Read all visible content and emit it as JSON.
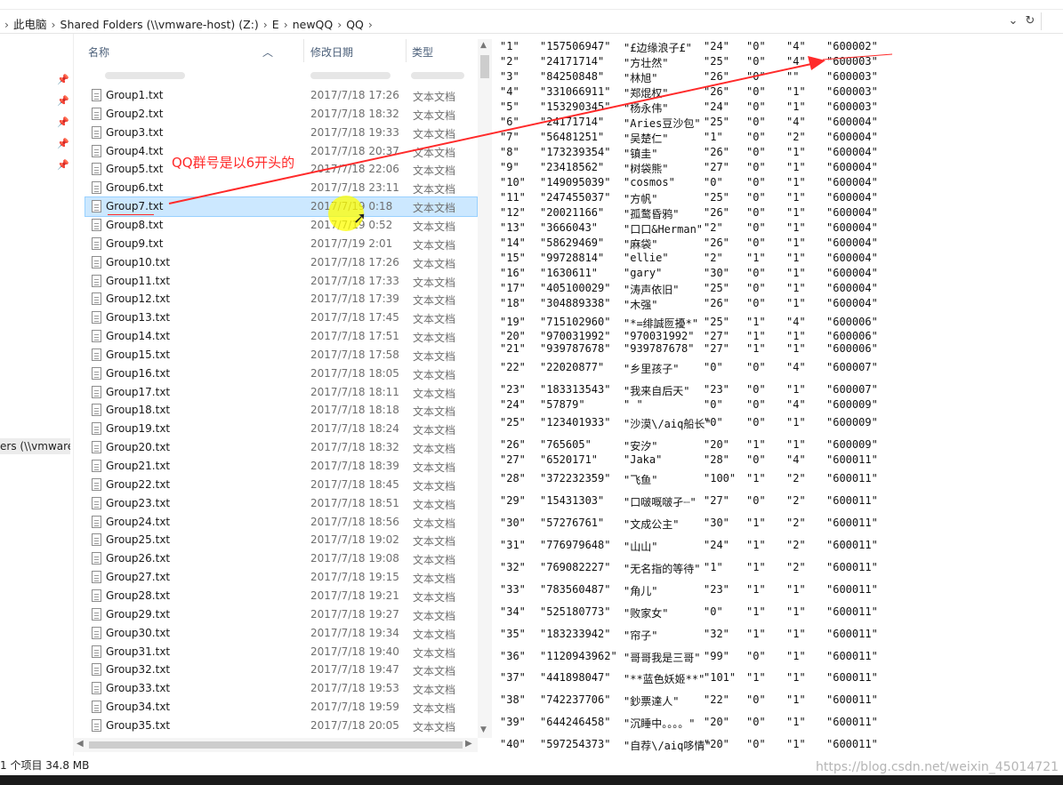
{
  "address": {
    "crumbs": [
      "此电脑",
      "Shared Folders (\\\\vmware-host) (Z:)",
      "E",
      "newQQ",
      "QQ"
    ],
    "refresh_icon": "refresh-icon",
    "dropdown_icon": "chevron-down-icon"
  },
  "nav": {
    "item_label": "ers (\\\\vmware-"
  },
  "columns": {
    "name": "名称",
    "date": "修改日期",
    "type": "类型"
  },
  "files": [
    {
      "name": "Group1.txt",
      "date": "2017/7/18 17:26",
      "type": "文本文档"
    },
    {
      "name": "Group2.txt",
      "date": "2017/7/18 18:32",
      "type": "文本文档"
    },
    {
      "name": "Group3.txt",
      "date": "2017/7/18 19:33",
      "type": "文本文档"
    },
    {
      "name": "Group4.txt",
      "date": "2017/7/18 20:37",
      "type": "文本文档"
    },
    {
      "name": "Group5.txt",
      "date": "2017/7/18 22:06",
      "type": "文本文档"
    },
    {
      "name": "Group6.txt",
      "date": "2017/7/18 23:11",
      "type": "文本文档"
    },
    {
      "name": "Group7.txt",
      "date": "2017/7/19 0:18",
      "type": "文本文档",
      "selected": true
    },
    {
      "name": "Group8.txt",
      "date": "2017/7/19 0:52",
      "type": "文本文档"
    },
    {
      "name": "Group9.txt",
      "date": "2017/7/19 2:01",
      "type": "文本文档"
    },
    {
      "name": "Group10.txt",
      "date": "2017/7/18 17:26",
      "type": "文本文档"
    },
    {
      "name": "Group11.txt",
      "date": "2017/7/18 17:33",
      "type": "文本文档"
    },
    {
      "name": "Group12.txt",
      "date": "2017/7/18 17:39",
      "type": "文本文档"
    },
    {
      "name": "Group13.txt",
      "date": "2017/7/18 17:45",
      "type": "文本文档"
    },
    {
      "name": "Group14.txt",
      "date": "2017/7/18 17:51",
      "type": "文本文档"
    },
    {
      "name": "Group15.txt",
      "date": "2017/7/18 17:58",
      "type": "文本文档"
    },
    {
      "name": "Group16.txt",
      "date": "2017/7/18 18:05",
      "type": "文本文档"
    },
    {
      "name": "Group17.txt",
      "date": "2017/7/18 18:11",
      "type": "文本文档"
    },
    {
      "name": "Group18.txt",
      "date": "2017/7/18 18:18",
      "type": "文本文档"
    },
    {
      "name": "Group19.txt",
      "date": "2017/7/18 18:24",
      "type": "文本文档"
    },
    {
      "name": "Group20.txt",
      "date": "2017/7/18 18:32",
      "type": "文本文档"
    },
    {
      "name": "Group21.txt",
      "date": "2017/7/18 18:39",
      "type": "文本文档"
    },
    {
      "name": "Group22.txt",
      "date": "2017/7/18 18:45",
      "type": "文本文档"
    },
    {
      "name": "Group23.txt",
      "date": "2017/7/18 18:51",
      "type": "文本文档"
    },
    {
      "name": "Group24.txt",
      "date": "2017/7/18 18:56",
      "type": "文本文档"
    },
    {
      "name": "Group25.txt",
      "date": "2017/7/18 19:02",
      "type": "文本文档"
    },
    {
      "name": "Group26.txt",
      "date": "2017/7/18 19:08",
      "type": "文本文档"
    },
    {
      "name": "Group27.txt",
      "date": "2017/7/18 19:15",
      "type": "文本文档"
    },
    {
      "name": "Group28.txt",
      "date": "2017/7/18 19:21",
      "type": "文本文档"
    },
    {
      "name": "Group29.txt",
      "date": "2017/7/18 19:27",
      "type": "文本文档"
    },
    {
      "name": "Group30.txt",
      "date": "2017/7/18 19:34",
      "type": "文本文档"
    },
    {
      "name": "Group31.txt",
      "date": "2017/7/18 19:40",
      "type": "文本文档"
    },
    {
      "name": "Group32.txt",
      "date": "2017/7/18 19:47",
      "type": "文本文档"
    },
    {
      "name": "Group33.txt",
      "date": "2017/7/18 19:53",
      "type": "文本文档"
    },
    {
      "name": "Group34.txt",
      "date": "2017/7/18 19:59",
      "type": "文本文档"
    },
    {
      "name": "Group35.txt",
      "date": "2017/7/18 20:05",
      "type": "文本文档"
    }
  ],
  "status": {
    "text": "1 个项目  34.8 MB"
  },
  "annotation": {
    "text": "QQ群号是以6开头的"
  },
  "watermark": "https://blog.csdn.net/weixin_45014721",
  "data_lines": [
    [
      "\"1\"",
      "\"157506947\"",
      "\"£边缘浪子£\"",
      "\"24\"",
      "\"0\"",
      "\"4\"",
      "\"600002\""
    ],
    [
      "\"2\"",
      "\"24171714\"",
      "\"方壮然\"",
      "\"25\"",
      "\"0\"",
      "\"4\"",
      "\"600003\""
    ],
    [
      "\"3\"",
      "\"84250848\"",
      "\"林旭\"",
      "\"26\"",
      "\"0\"",
      "\"\"",
      "\"600003\""
    ],
    [
      "\"4\"",
      "\"331066911\"",
      "\"郑焜权\"",
      "\"26\"",
      "\"0\"",
      "\"1\"",
      "\"600003\""
    ],
    [
      "\"5\"",
      "\"153290345\"",
      "\"杨永伟\"",
      "\"24\"",
      "\"0\"",
      "\"1\"",
      "\"600003\""
    ],
    [
      "\"6\"",
      "\"24171714\"",
      "\"Aries豆沙包\"",
      "\"25\"",
      "\"0\"",
      "\"4\"",
      "\"600004\""
    ],
    [
      "\"7\"",
      "\"56481251\"",
      "\"吴楚仁\"",
      "\"1\"",
      "\"0\"",
      "\"2\"",
      "\"600004\""
    ],
    [
      "\"8\"",
      "\"173239354\"",
      "\"镇圭\"",
      "\"26\"",
      "\"0\"",
      "\"1\"",
      "\"600004\""
    ],
    [
      "\"9\"",
      "\"23418562\"",
      "\"树袋熊\"",
      "\"27\"",
      "\"0\"",
      "\"1\"",
      "\"600004\""
    ],
    [
      "\"10\"",
      "\"149095039\"",
      "\"cosmos\"",
      "\"0\"",
      "\"0\"",
      "\"1\"",
      "\"600004\""
    ],
    [
      "\"11\"",
      "\"247455037\"",
      "\"方帆\"",
      "\"25\"",
      "\"0\"",
      "\"1\"",
      "\"600004\""
    ],
    [
      "\"12\"",
      "\"20021166\"",
      "\"孤鹜昏鸦\"",
      "\"26\"",
      "\"0\"",
      "\"1\"",
      "\"600004\""
    ],
    [
      "\"13\"",
      "\"3666043\"",
      "\"口口&Herman\"",
      "\"2\"",
      "\"0\"",
      "\"1\"",
      "\"600004\""
    ],
    [
      "\"14\"",
      "\"58629469\"",
      "\"麻袋\"",
      "\"26\"",
      "\"0\"",
      "\"1\"",
      "\"600004\""
    ],
    [
      "\"15\"",
      "\"99728814\"",
      "\"ellie\"",
      "\"2\"",
      "\"1\"",
      "\"1\"",
      "\"600004\""
    ],
    [
      "\"16\"",
      "\"1630611\"",
      "\"gary\"",
      "\"30\"",
      "\"0\"",
      "\"1\"",
      "\"600004\""
    ],
    [
      "\"17\"",
      "\"405100029\"",
      "\"涛声依旧\"",
      "\"25\"",
      "\"0\"",
      "\"1\"",
      "\"600004\""
    ],
    [
      "\"18\"",
      "\"304889338\"",
      "\"木强\"",
      "\"26\"",
      "\"0\"",
      "\"1\"",
      "\"600004\""
    ],
    [
      "\"19\"",
      "\"715102960\"",
      "\"*=绯誠匢擾*\"",
      "\"25\"",
      "\"1\"",
      "\"4\"",
      "\"600006\""
    ],
    [
      "\"20\"",
      "\"970031992\"",
      "\"970031992\"",
      "\"27\"",
      "\"1\"",
      "\"1\"",
      "\"600006\""
    ],
    [
      "\"21\"",
      "\"939787678\"",
      "\"939787678\"",
      "\"27\"",
      "\"1\"",
      "\"1\"",
      "\"600006\""
    ],
    [
      "\"22\"",
      "\"22020877\"",
      "\"乡里孩子\"",
      "\"0\"",
      "\"0\"",
      "\"4\"",
      "\"600007\""
    ],
    [
      "\"23\"",
      "\"183313543\"",
      "\"我来自后天\"",
      "\"23\"",
      "\"0\"",
      "\"1\"",
      "\"600007\""
    ],
    [
      "\"24\"",
      "\"57879\"",
      "\" \"",
      "\"0\"",
      "\"0\"",
      "\"4\"",
      "\"600009\""
    ],
    [
      "\"25\"",
      "\"123401933\"",
      "\"沙漠\\/aiq船长\"",
      "\"0\"",
      "\"0\"",
      "\"1\"",
      "\"600009\""
    ],
    [
      "\"26\"",
      "\"765605\"",
      "\"安汐\"",
      "\"20\"",
      "\"1\"",
      "\"1\"",
      "\"600009\""
    ],
    [
      "\"27\"",
      "\"6520171\"",
      "\"Jaka\"",
      "\"28\"",
      "\"0\"",
      "\"4\"",
      "\"600011\""
    ],
    [
      "\"28\"",
      "\"372232359\"",
      "\"飞鱼\"",
      "\"100\"",
      "\"1\"",
      "\"2\"",
      "\"600011\""
    ],
    [
      "\"29\"",
      "\"15431303\"",
      "\"口啵嘅啵孑┈\"",
      "\"27\"",
      "\"0\"",
      "\"2\"",
      "\"600011\""
    ],
    [
      "\"30\"",
      "\"57276761\"",
      "\"文成公主\"",
      "\"30\"",
      "\"1\"",
      "\"2\"",
      "\"600011\""
    ],
    [
      "\"31\"",
      "\"776979648\"",
      "\"山山\"",
      "\"24\"",
      "\"1\"",
      "\"2\"",
      "\"600011\""
    ],
    [
      "\"32\"",
      "\"769082227\"",
      "\"无名指的等待\"",
      "\"1\"",
      "\"1\"",
      "\"2\"",
      "\"600011\""
    ],
    [
      "\"33\"",
      "\"783560487\"",
      "\"角儿\"",
      "\"23\"",
      "\"1\"",
      "\"1\"",
      "\"600011\""
    ],
    [
      "\"34\"",
      "\"525180773\"",
      "\"败家女\"",
      "\"0\"",
      "\"1\"",
      "\"1\"",
      "\"600011\""
    ],
    [
      "\"35\"",
      "\"183233942\"",
      "\"帘子\"",
      "\"32\"",
      "\"1\"",
      "\"1\"",
      "\"600011\""
    ],
    [
      "\"36\"",
      "\"1120943962\"",
      "\"哥哥我是三哥\"",
      "\"99\"",
      "\"0\"",
      "\"1\"",
      "\"600011\""
    ],
    [
      "\"37\"",
      "\"441898047\"",
      "\"**蓝色妖姬**\"",
      "\"101\"",
      "\"1\"",
      "\"1\"",
      "\"600011\""
    ],
    [
      "\"38\"",
      "\"742237706\"",
      "\"鈔票達人\"",
      "\"22\"",
      "\"0\"",
      "\"1\"",
      "\"600011\""
    ],
    [
      "\"39\"",
      "\"644246458\"",
      "\"沉睡中。。。。\"",
      "\"20\"",
      "\"0\"",
      "\"1\"",
      "\"600011\""
    ],
    [
      "\"40\"",
      "\"597254373\"",
      "\"自荐\\/aiq哆情\"",
      "\"20\"",
      "\"0\"",
      "\"1\"",
      "\"600011\""
    ]
  ]
}
